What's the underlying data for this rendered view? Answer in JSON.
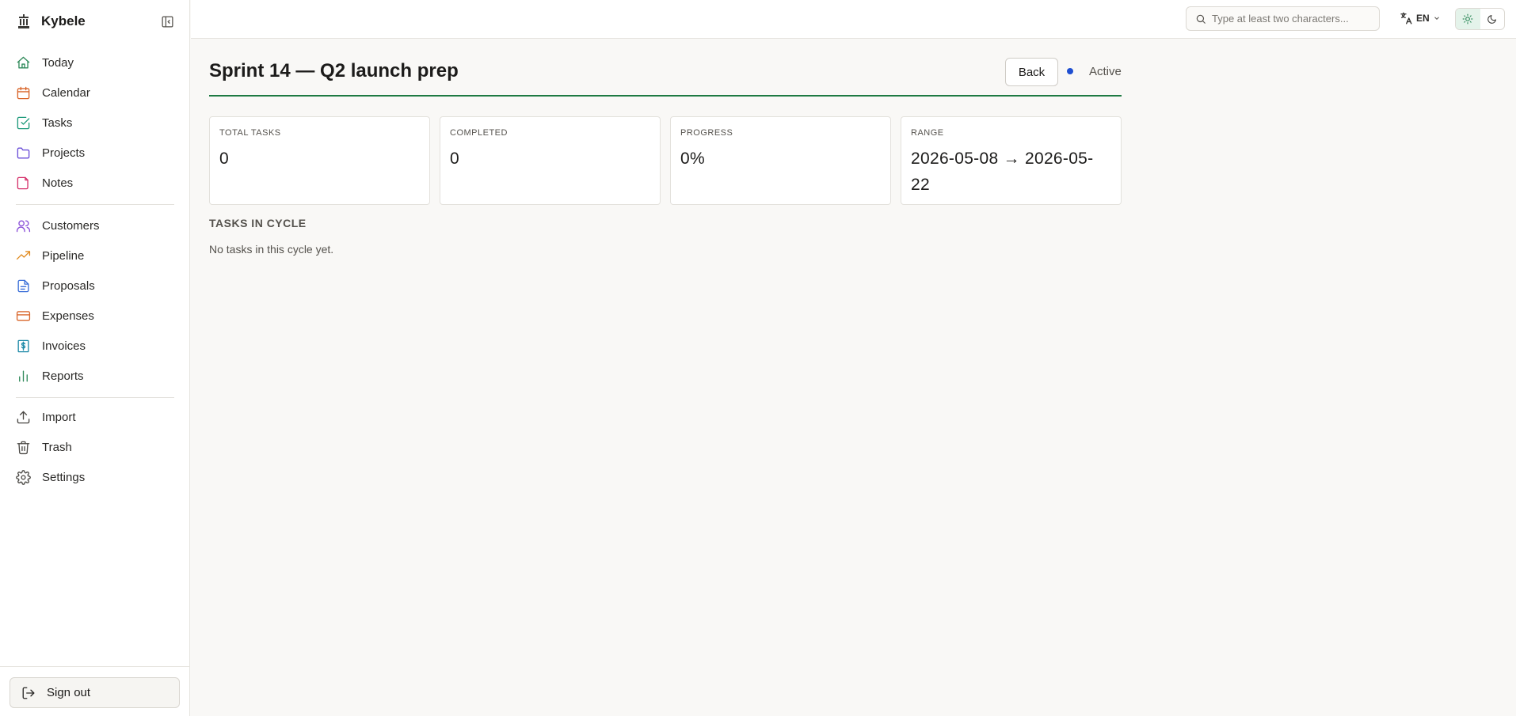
{
  "app": {
    "name": "Kybele"
  },
  "sidebar": {
    "groups": [
      [
        {
          "label": "Today",
          "icon": "home-icon",
          "color": "#2f8a5a"
        },
        {
          "label": "Calendar",
          "icon": "calendar-icon",
          "color": "#d9662b"
        },
        {
          "label": "Tasks",
          "icon": "check-square-icon",
          "color": "#1e9a7b"
        },
        {
          "label": "Projects",
          "icon": "folder-icon",
          "color": "#6b4fd8"
        },
        {
          "label": "Notes",
          "icon": "note-icon",
          "color": "#d6336c"
        }
      ],
      [
        {
          "label": "Customers",
          "icon": "users-icon",
          "color": "#8a4fd8"
        },
        {
          "label": "Pipeline",
          "icon": "trending-up-icon",
          "color": "#e08a1e"
        },
        {
          "label": "Proposals",
          "icon": "file-text-icon",
          "color": "#3b6fd8"
        },
        {
          "label": "Expenses",
          "icon": "credit-card-icon",
          "color": "#d9662b"
        },
        {
          "label": "Invoices",
          "icon": "receipt-icon",
          "color": "#1e8aa8"
        },
        {
          "label": "Reports",
          "icon": "bar-chart-icon",
          "color": "#2f8a5a"
        }
      ],
      [
        {
          "label": "Import",
          "icon": "upload-icon",
          "color": "#4a4844"
        },
        {
          "label": "Trash",
          "icon": "trash-icon",
          "color": "#4a4844"
        },
        {
          "label": "Settings",
          "icon": "gear-icon",
          "color": "#4a4844"
        }
      ]
    ],
    "signout_label": "Sign out"
  },
  "topbar": {
    "search_placeholder": "Type at least two characters...",
    "language": "EN",
    "theme_active": "light"
  },
  "main": {
    "title": "Sprint 14 — Q2 launch prep",
    "back_label": "Back",
    "status": "Active",
    "status_color": "#1f4fd1",
    "accent_color": "#1e7a43",
    "stats": [
      {
        "label": "TOTAL TASKS",
        "value": "0"
      },
      {
        "label": "COMPLETED",
        "value": "0"
      },
      {
        "label": "PROGRESS",
        "value": "0%"
      },
      {
        "label": "RANGE",
        "value": "2026-05-08 → 2026-05-22"
      }
    ],
    "section_title": "TASKS IN CYCLE",
    "empty_text": "No tasks in this cycle yet."
  }
}
